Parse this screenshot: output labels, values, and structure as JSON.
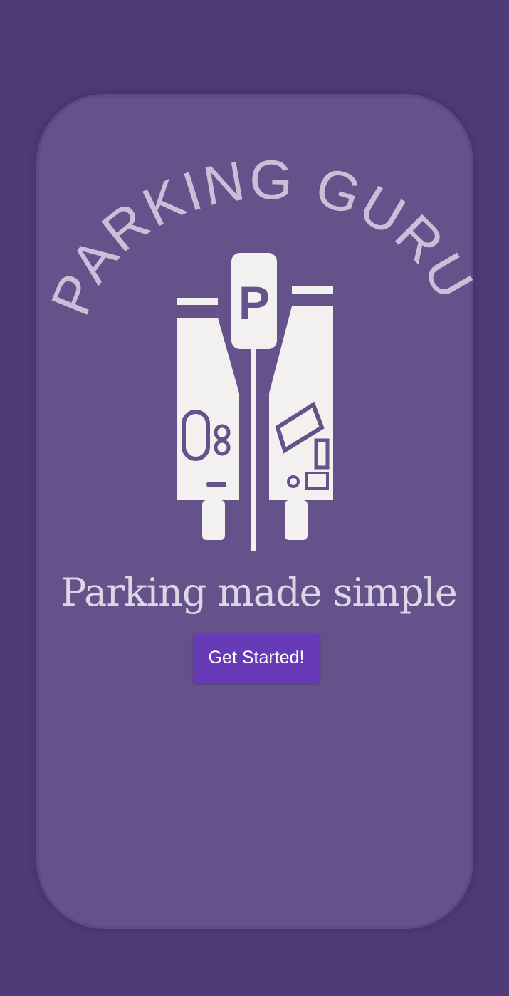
{
  "app": {
    "logo_text": "PARKING GURU",
    "parking_sign": "P",
    "tagline": "Parking made simple"
  },
  "actions": {
    "get_started_label": "Get Started!"
  },
  "colors": {
    "background": "#513a78",
    "card": "#65528b",
    "logo_text": "#c9bfd8",
    "icon": "#f3f1ef",
    "button": "#673ab7",
    "button_text": "#ffffff"
  }
}
